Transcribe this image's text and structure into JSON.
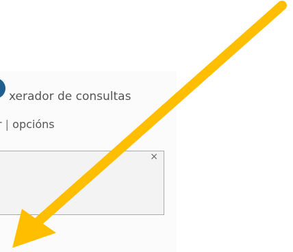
{
  "widget": {
    "title": "xerador de consultas",
    "link_partial": "r",
    "link_separator": "|",
    "link_options": "opcións",
    "close_symbol": "×"
  },
  "annotation": {
    "arrow_color": "#ffbf00"
  },
  "colors": {
    "logo": "#1f5f8f",
    "panel_background": "#fbfbfb",
    "box_background": "#f3f3f3",
    "box_border": "#aaaaaa",
    "text": "#555555"
  }
}
